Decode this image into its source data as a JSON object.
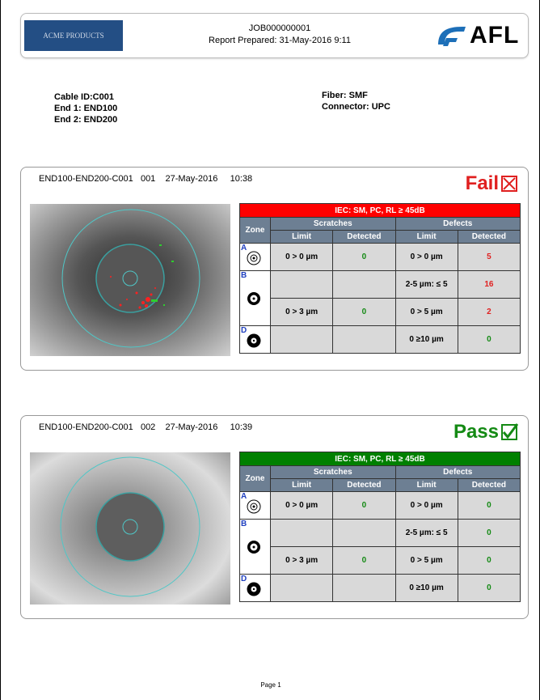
{
  "header": {
    "company": "ACME PRODUCTS",
    "job": "JOB000000001",
    "prepared": "Report Prepared:  31-May-2016   9:11",
    "logo_text": "AFL"
  },
  "info": {
    "cable_id": "Cable ID:C001",
    "end1": "End 1: END100",
    "end2": "End 2: END200",
    "fiber": "Fiber: SMF",
    "connector": "Connector: UPC"
  },
  "table_labels": {
    "zone": "Zone",
    "scratches": "Scratches",
    "defects": "Defects",
    "limit": "Limit",
    "detected": "Detected"
  },
  "results": [
    {
      "title": "END100-END200-C001   001    27-May-2016     10:38",
      "verdict": "Fail",
      "verdict_color": "#e02020",
      "standard": "IEC: SM, PC, RL ≥ 45dB",
      "standard_color": "#ff0000",
      "zones": {
        "A": {
          "letter": "A",
          "s_limit": "0 > 0 µm",
          "s_detected": "0",
          "d_limit": "0 > 0 µm",
          "d_detected": "5"
        },
        "B": {
          "letter": "B",
          "d_limit": "2-5 µm: ≤ 5",
          "d_detected": "16",
          "s_limit": "0 > 3 µm",
          "s_detected": "0",
          "d_limit2": "0 > 5 µm",
          "d_detected2": "2"
        },
        "D": {
          "letter": "D",
          "d_limit": "0 ≥10 µm",
          "d_detected": "0"
        }
      }
    },
    {
      "title": "END100-END200-C001   002    27-May-2016     10:39",
      "verdict": "Pass",
      "verdict_color": "#148a14",
      "standard": "IEC: SM, PC, RL ≥ 45dB",
      "standard_color": "#008000",
      "zones": {
        "A": {
          "letter": "A",
          "s_limit": "0 > 0 µm",
          "s_detected": "0",
          "d_limit": "0 > 0 µm",
          "d_detected": "0"
        },
        "B": {
          "letter": "B",
          "d_limit": "2-5 µm: ≤ 5",
          "d_detected": "0",
          "s_limit": "0 > 3 µm",
          "s_detected": "0",
          "d_limit2": "0 > 5 µm",
          "d_detected2": "0"
        },
        "D": {
          "letter": "D",
          "d_limit": "0 ≥10 µm",
          "d_detected": "0"
        }
      }
    }
  ],
  "footer": "Page 1"
}
